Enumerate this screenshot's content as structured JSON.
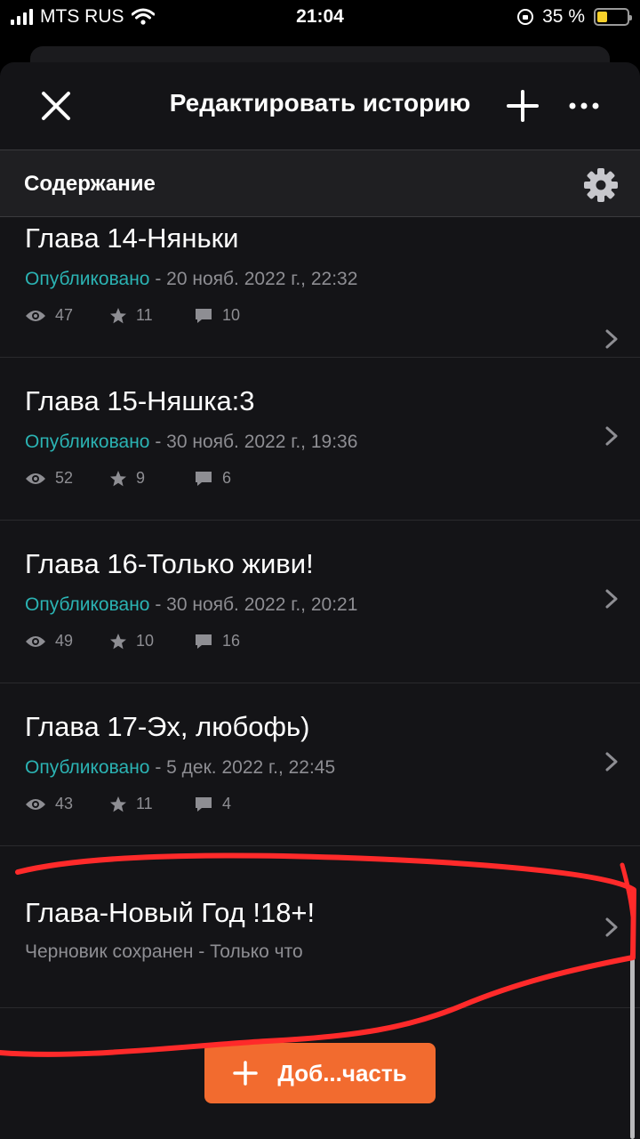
{
  "status_bar": {
    "carrier": "MTS RUS",
    "time": "21:04",
    "battery": "35 %",
    "battery_level": 0.35
  },
  "header": {
    "title": "Редактировать историю",
    "close_icon": "close-icon",
    "add_icon": "plus-icon",
    "more_icon": "more-icon"
  },
  "section": {
    "title": "Содержание",
    "settings_icon": "gear-icon"
  },
  "parts": [
    {
      "title": "Глава 14-Няньки",
      "status": "Опубликовано",
      "meta": " - 20 нояб. 2022 г., 22:32",
      "views": "47",
      "votes": "11",
      "comments": "10"
    },
    {
      "title": "Глава 15-Няшка:3",
      "status": "Опубликовано",
      "meta": " - 30 нояб. 2022 г., 19:36",
      "views": "52",
      "votes": "9",
      "comments": "6"
    },
    {
      "title": "Глава 16-Только живи!",
      "status": "Опубликовано",
      "meta": " - 30 нояб. 2022 г., 20:21",
      "views": "49",
      "votes": "10",
      "comments": "16"
    },
    {
      "title": "Глава 17-Эх, любофь)",
      "status": "Опубликовано",
      "meta": " - 5 дек. 2022 г., 22:45",
      "views": "43",
      "votes": "11",
      "comments": "4"
    }
  ],
  "draft": {
    "title": "Глава-Новый Год !18+!",
    "meta": "Черновик сохранен - Только что"
  },
  "add_part_button": {
    "label": "Доб...часть",
    "icon": "plus-icon"
  },
  "colors": {
    "accent": "#f26b2f",
    "published": "#2bb3b3",
    "annotation": "#ff2a2a",
    "background": "#141417"
  }
}
